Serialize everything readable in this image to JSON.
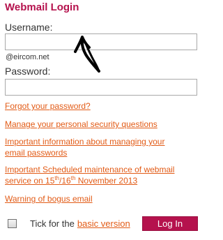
{
  "login": {
    "title": "Webmail Login",
    "username_label": "Username:",
    "username_value": "",
    "domain_hint": "@eircom.net",
    "password_label": "Password:",
    "password_value": ""
  },
  "links": {
    "forgot": "Forgot your password?",
    "security": "Manage your personal security questions",
    "info_line1": "Important information about managing your",
    "info_line2": "email passwords",
    "maintenance_line1": "Important Scheduled maintenance of webmail",
    "maintenance_line2_pre": "service on 15",
    "maintenance_sup1": "th",
    "maintenance_slash": "/16",
    "maintenance_sup2": "th",
    "maintenance_line2_post": " November 2013",
    "bogus": "Warning of bogus email"
  },
  "footer": {
    "tick_prefix": "Tick for the",
    "basic_link": "basic version",
    "login_button": "Log In"
  },
  "colors": {
    "brand": "#b5124d",
    "link": "#e25b16"
  }
}
